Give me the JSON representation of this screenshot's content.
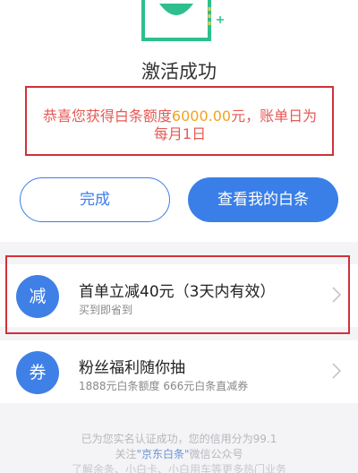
{
  "header": {
    "title": "激活成功",
    "message_prefix": "恭喜您获得白条额度",
    "message_amount": "6000.00",
    "message_suffix": "元，账单日为每月1日"
  },
  "actions": {
    "done_label": "完成",
    "view_label": "查看我的白条"
  },
  "offers": [
    {
      "badge": "减",
      "title": "首单立减40元（3天内有效）",
      "subtitle": "买到即省到"
    },
    {
      "badge": "券",
      "title": "粉丝福利随你抽",
      "subtitle": "1888元白条额度 666元白条直减券"
    }
  ],
  "footer": {
    "line1": "已为您实名认证成功，您的信用分为99.1",
    "line2_prefix": "关注",
    "line2_link": "\"京东白条\"",
    "line2_suffix": "微信公众号",
    "line3": "了解余条、小白卡、小白用车等更多热门业务"
  },
  "colors": {
    "accent": "#3a7fe8",
    "highlight_text": "#e55a56",
    "amount": "#f4a21f",
    "annotation_border": "#d0313a"
  }
}
